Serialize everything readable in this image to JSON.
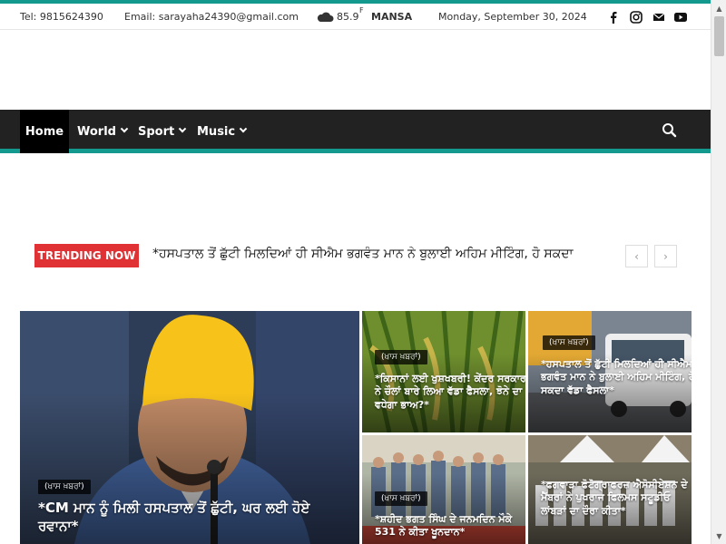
{
  "topbar": {
    "tel": "Tel: 9815624390",
    "email": "Email: sarayaha24390@gmail.com",
    "temp": "85.9",
    "unit": "F",
    "city": "MANSA",
    "date": "Monday, September 30, 2024"
  },
  "social_icons": [
    "facebook-icon",
    "instagram-icon",
    "mail-icon",
    "youtube-icon"
  ],
  "menu": {
    "items": [
      {
        "label": "Home"
      },
      {
        "label": "World"
      },
      {
        "label": "Sport"
      },
      {
        "label": "Music"
      }
    ]
  },
  "trending": {
    "badge": "TRENDING NOW",
    "text": "*ਹਸਪਤਾਲ ਤੋਂ ਛੁੱਟੀ ਮਿਲਦਿਆਂ ਹੀ ਸੀਐਮ ਭਗਵੰਤ ਮਾਨ ਨੇ ਬੁਲਾਈ ਅਹਿਮ ਮੀਟਿੰਗ, ਹੋ ਸਕਦਾ",
    "prev": "‹",
    "next": "›"
  },
  "cards": [
    {
      "tag": "(ਖਾਸ ਖ਼ਬਰਾਂ)",
      "title": "*CM ਮਾਨ ਨੂੰ ਮਿਲੀ ਹਸਪਤਾਲ ਤੋਂ ਛੁੱਟੀ, ਘਰ ਲਈ ਹੋਏ ਰਵਾਨਾ*"
    },
    {
      "tag": "(ਖਾਸ ਖ਼ਬਰਾਂ)",
      "title": "*ਕਿਸਾਨਾਂ ਲਈ ਖੁਸ਼ਖਬਰੀ! ਕੇਂਦਰ ਸਰਕਾਰ ਨੇ ਚੌਲਾਂ ਬਾਰੇ ਲਿਆ ਵੱਡਾ ਫੈਸਲਾ, ਝੋਨੇ ਦਾ ਵਧੇਗਾ ਭਾਅ?*"
    },
    {
      "tag": "(ਖਾਸ ਖ਼ਬਰਾਂ)",
      "title": "*ਹਸਪਤਾਲ ਤੋਂ ਛੁੱਟੀ ਮਿਲਦਿਆਂ ਹੀ ਸੀਐਮ ਭਗਵੰਤ ਮਾਨ ਨੇ ਬੁਲਾਈ ਅਹਿਮ ਮੀਟਿੰਗ, ਹੋ ਸਕਦਾ ਵੱਡਾ ਫੈਸਲਾ*"
    },
    {
      "tag": "(ਖਾਸ ਖ਼ਬਰਾਂ)",
      "title": "*ਸ਼ਹੀਦ ਭਗਤ ਸਿੰਘ ਦੇ ਜਨਮਦਿਨ ਮੌਕੇ 531 ਨੇ ਕੀਤਾ ਖੂਨਦਾਨ*"
    },
    {
      "tag": "(ਖਾਸ ਖ਼ਬਰਾਂ)",
      "title": "*ਫਗਵਾੜਾ ਫੋਟੋਗ੍ਰਾਫਰਜ਼ ਐਸੋਸੀਏਸ਼ਨ ਦੇ ਮੈਂਬਰਾਂ ਨੇ ਪੁਖਰਾਜ ਫਿਲਮਸ ਸਟੂਡੀਓ ਲਾਂਬੜਾਂ ਦਾ ਦੌਰਾ ਕੀਤਾ*"
    }
  ],
  "colors": {
    "accent": "#14998e",
    "nav": "#222222",
    "trending": "#e03134"
  }
}
